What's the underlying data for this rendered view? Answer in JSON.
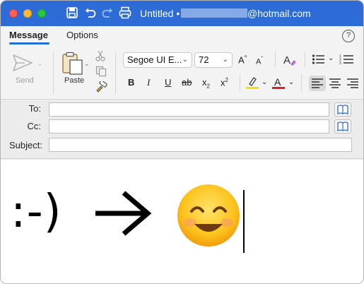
{
  "window": {
    "title": "Untitled •",
    "recipient_email_suffix": "@hotmail.com"
  },
  "tabs": [
    {
      "label": "Message",
      "active": true
    },
    {
      "label": "Options",
      "active": false
    }
  ],
  "ribbon": {
    "send_label": "Send",
    "paste_label": "Paste",
    "font_name": "Segoe UI E...",
    "font_size": "72",
    "format_buttons": {
      "bold": "B",
      "italic": "I",
      "underline": "U",
      "strikethrough": "ab",
      "subscript_base": "x",
      "subscript_mark": "2",
      "superscript_base": "x",
      "superscript_mark": "2",
      "grow_font": "A",
      "shrink_font": "A"
    },
    "highlight_color": "#f5e000",
    "font_color": "#e02020"
  },
  "fields": {
    "to_label": "To:",
    "cc_label": "Cc:",
    "subject_label": "Subject:",
    "to_value": "",
    "cc_value": "",
    "subject_value": ""
  },
  "body": {
    "emoticon_text": ":-)"
  },
  "colors": {
    "titlebar": "#2d6bd6",
    "tab_accent": "#1f6fd6"
  }
}
